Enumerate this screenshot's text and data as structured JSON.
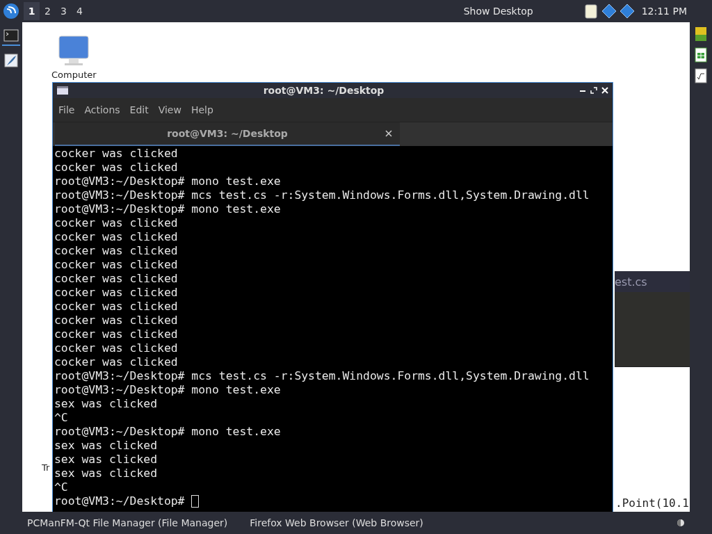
{
  "top_panel": {
    "workspaces": [
      {
        "label": "1",
        "selected": true
      },
      {
        "label": "2",
        "selected": false
      },
      {
        "label": "3",
        "selected": false
      },
      {
        "label": "4",
        "selected": false
      }
    ],
    "show_desktop": "Show Desktop",
    "clock": "12:11 PM"
  },
  "left_dock": {
    "items": [
      {
        "kind": "terminal",
        "selected": true
      },
      {
        "kind": "editor",
        "selected": false
      }
    ]
  },
  "right_dock": {
    "items": [
      {
        "kind": "qt"
      },
      {
        "kind": "sheet"
      },
      {
        "kind": "math"
      }
    ]
  },
  "desktop": {
    "icons": [
      {
        "label": "Computer"
      }
    ],
    "stray_text": "Tr"
  },
  "background_window": {
    "title": "est.cs",
    "code_fragment": ".Point(10.1"
  },
  "terminal": {
    "title": "root@VM3: ~/Desktop",
    "menu": [
      "File",
      "Actions",
      "Edit",
      "View",
      "Help"
    ],
    "tabs": [
      {
        "label": "root@VM3: ~/Desktop",
        "selected": true
      }
    ],
    "lines": [
      "cocker was clicked",
      "cocker was clicked",
      "root@VM3:~/Desktop# mono test.exe",
      "root@VM3:~/Desktop# mcs test.cs -r:System.Windows.Forms.dll,System.Drawing.dll",
      "root@VM3:~/Desktop# mono test.exe",
      "cocker was clicked",
      "cocker was clicked",
      "cocker was clicked",
      "cocker was clicked",
      "cocker was clicked",
      "cocker was clicked",
      "cocker was clicked",
      "cocker was clicked",
      "cocker was clicked",
      "cocker was clicked",
      "cocker was clicked",
      "root@VM3:~/Desktop# mcs test.cs -r:System.Windows.Forms.dll,System.Drawing.dll",
      "root@VM3:~/Desktop# mono test.exe",
      "sex was clicked",
      "^C",
      "root@VM3:~/Desktop# mono test.exe",
      "sex was clicked",
      "sex was clicked",
      "sex was clicked",
      "^C",
      "root@VM3:~/Desktop# "
    ],
    "cursor_visible": true
  },
  "taskbar": {
    "items": [
      {
        "label": "PCManFM-Qt File Manager (File Manager)"
      },
      {
        "label": "Firefox Web Browser (Web Browser)"
      }
    ]
  }
}
